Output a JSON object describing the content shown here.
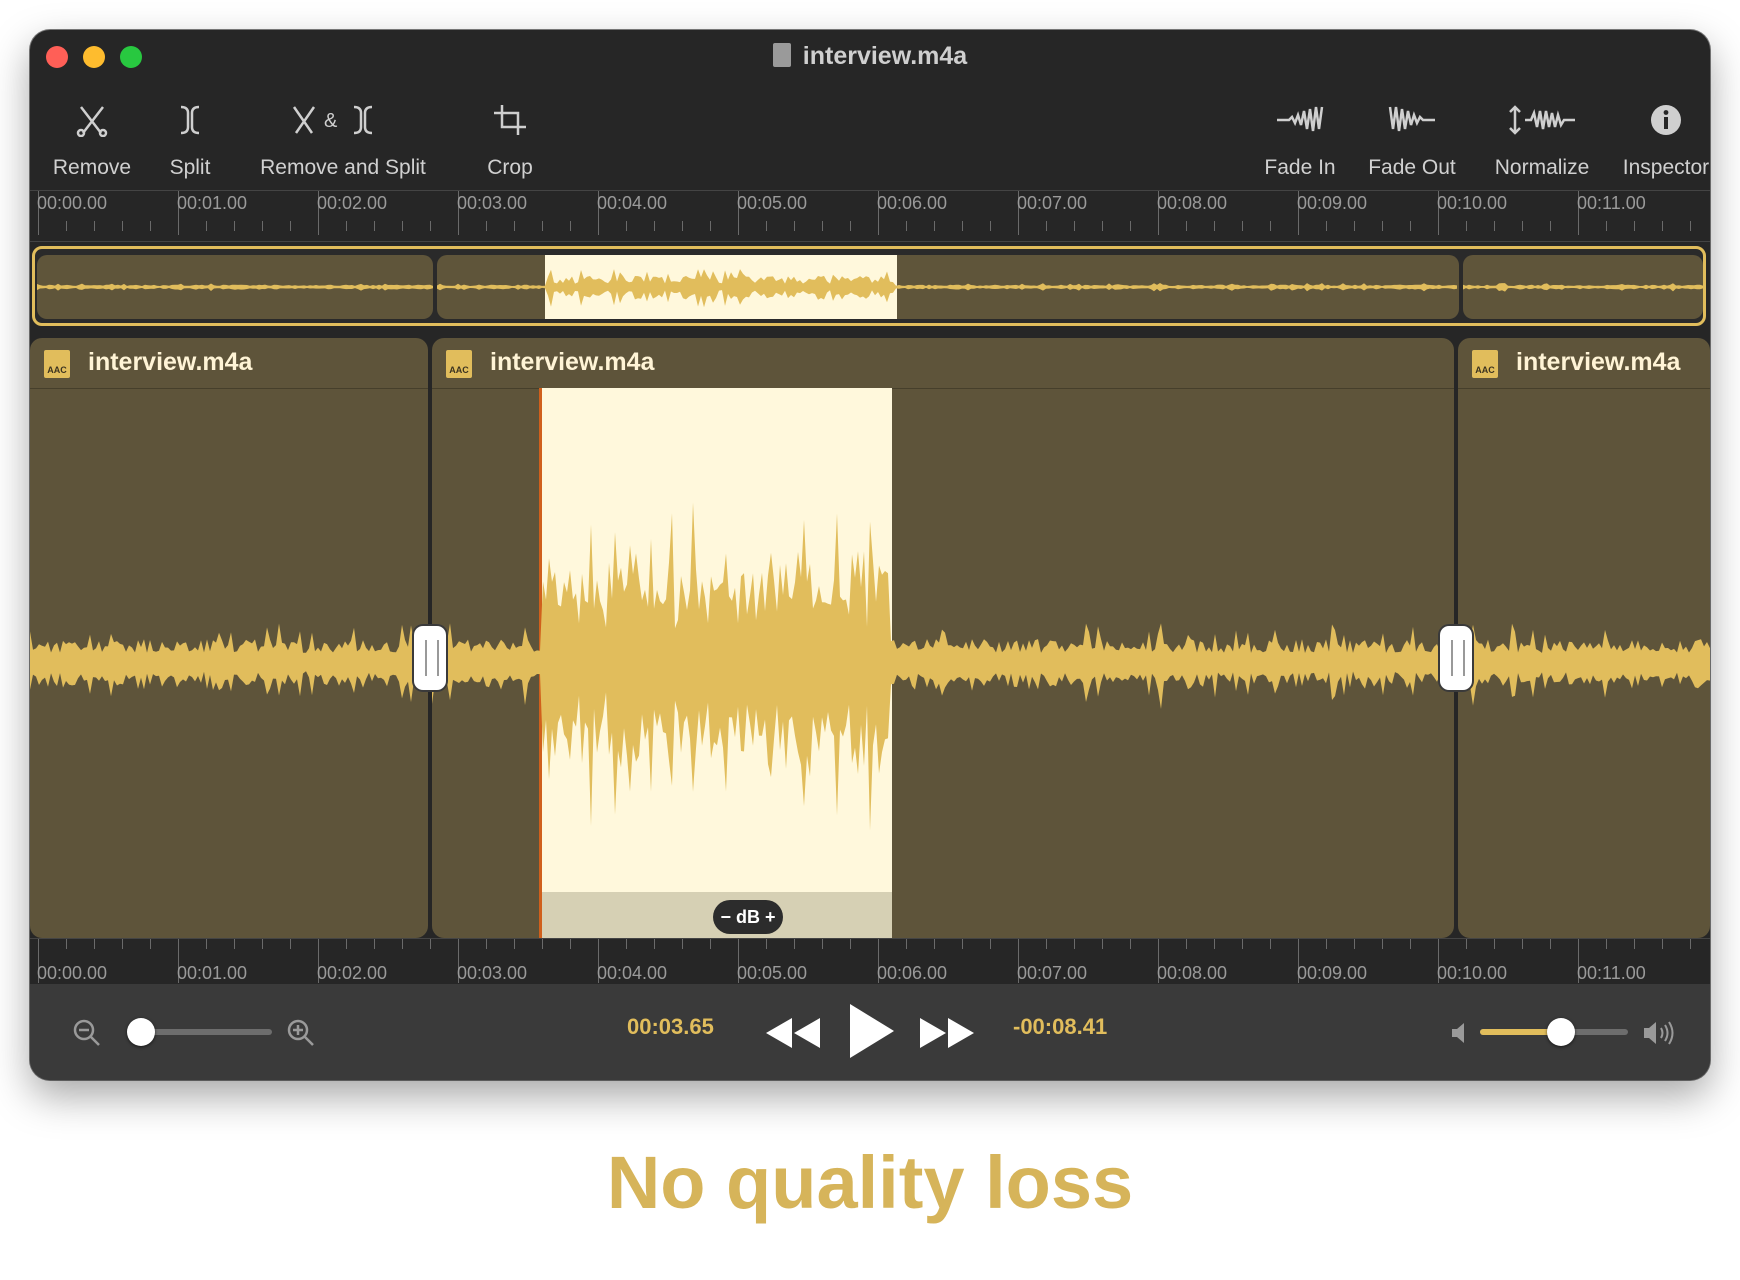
{
  "window": {
    "title": "interview.m4a"
  },
  "toolbar": {
    "remove_label": "Remove",
    "split_label": "Split",
    "remove_and_split_label": "Remove and Split",
    "crop_label": "Crop",
    "fade_in_label": "Fade In",
    "fade_out_label": "Fade Out",
    "normalize_label": "Normalize",
    "inspector_label": "Inspector",
    "icons": {
      "remove": "scissors-icon",
      "split": "split-icon",
      "remove_and_split": "scissors-and-split-icon",
      "crop": "crop-icon",
      "fade_in": "fade-in-icon",
      "fade_out": "fade-out-icon",
      "normalize": "normalize-icon",
      "inspector": "info-icon"
    }
  },
  "ruler": {
    "labels": [
      "00:00.00",
      "00:01.00",
      "00:02.00",
      "00:03.00",
      "00:04.00",
      "00:05.00",
      "00:06.00",
      "00:07.00",
      "00:08.00",
      "00:09.00",
      "00:10.00",
      "00:11.00"
    ]
  },
  "clips": [
    {
      "name": "interview.m4a",
      "badge": "AAC"
    },
    {
      "name": "interview.m4a",
      "badge": "AAC"
    },
    {
      "name": "interview.m4a",
      "badge": "AAC"
    }
  ],
  "selection": {
    "gain_control_label": "− dB +"
  },
  "transport": {
    "current_time": "00:03.65",
    "remaining_time": "-00:08.41",
    "zoom_level": 0.05,
    "volume_level": 0.55
  },
  "colors": {
    "accent": "#e1bd5c",
    "clip_background": "#5e543a",
    "selection_background": "#fff8dc",
    "window_background": "#262626"
  },
  "caption": "No quality loss"
}
